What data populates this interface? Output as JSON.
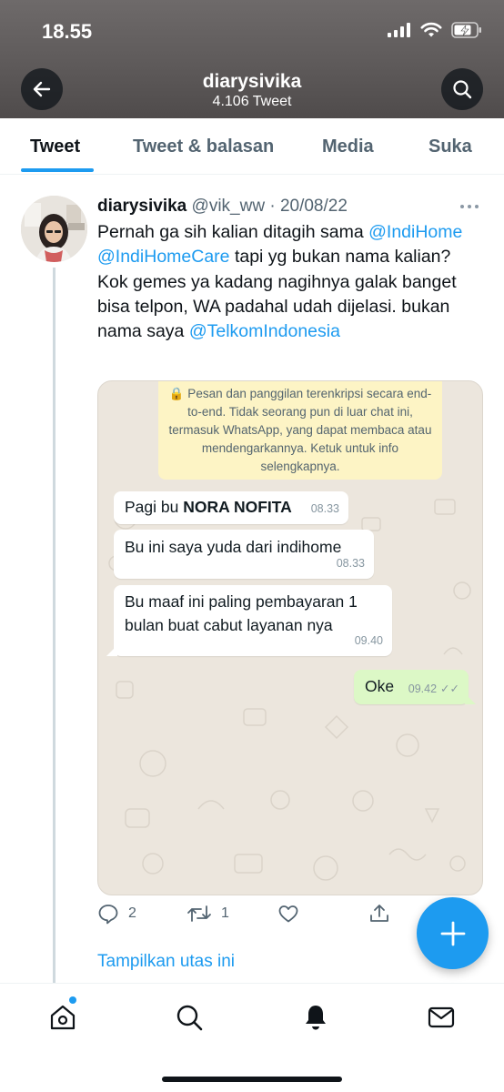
{
  "status_bar": {
    "time": "18.55"
  },
  "header": {
    "title": "diarysivika",
    "subtitle": "4.106 Tweet"
  },
  "tabs": [
    {
      "label": "Tweet",
      "active": true
    },
    {
      "label": "Tweet & balasan",
      "active": false
    },
    {
      "label": "Media",
      "active": false
    },
    {
      "label": "Suka",
      "active": false
    }
  ],
  "tweet": {
    "name": "diarysivika",
    "handle": "@vik_ww",
    "sep": " · ",
    "date": "20/08/22",
    "text": {
      "p1": "Pernah ga sih kalian ditagih sama ",
      "m1": "@IndiHome",
      "m2": "@IndiHomeCare",
      "p2": " tapi yg bukan nama kalian? Kok gemes ya kadang nagihnya galak banget bisa telpon, WA padahal udah dijelasi. bukan nama saya ",
      "m3": "@TelkomIndonesia"
    },
    "media": {
      "notice": "🔒 Pesan dan panggilan terenkripsi secara end-to-end. Tidak seorang pun di luar chat ini, termasuk WhatsApp, yang dapat membaca atau mendengarkannya. Ketuk untuk info selengkapnya.",
      "messages": [
        {
          "text_a": "Pagi bu ",
          "text_b": "NORA NOFITA",
          "time": "08.33"
        },
        {
          "text": "Bu ini saya yuda dari indihome",
          "time": "08.33"
        },
        {
          "text": "Bu maaf ini paling pembayaran 1 bulan buat cabut layanan nya",
          "time": "09.40"
        },
        {
          "text": "Oke",
          "time": "09.42",
          "checks": "✓✓"
        }
      ]
    },
    "actions": {
      "replies": "2",
      "retweets": "1"
    },
    "show_thread": "Tampilkan utas ini"
  },
  "colors": {
    "accent": "#1d9bf0",
    "text": "#0f1419",
    "muted": "#536471",
    "wa_bg": "#ece6dd",
    "wa_out": "#dcf8c6",
    "wa_notice": "#fdf4c5"
  },
  "icons": [
    "back-arrow-icon",
    "search-icon",
    "more-icon",
    "reply-icon",
    "retweet-icon",
    "like-icon",
    "share-icon",
    "compose-plus-icon",
    "home-icon",
    "explore-icon",
    "notifications-icon",
    "messages-icon",
    "signal-icon",
    "wifi-icon",
    "battery-icon",
    "lock-icon"
  ]
}
